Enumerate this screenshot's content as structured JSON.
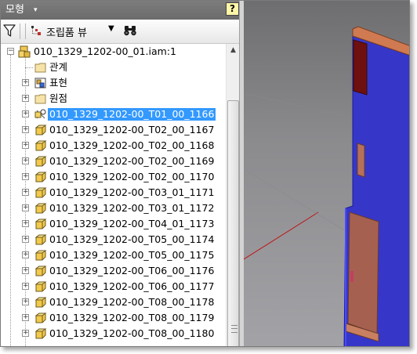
{
  "panel": {
    "title": "모형",
    "title_dropdown_glyph": "▾",
    "help_label": "?"
  },
  "toolbar": {
    "filter_icon": "funnel-icon",
    "view_label": "조립품 뷰",
    "view_dropdown_glyph": "▼",
    "find_icon": "binoculars-icon"
  },
  "tree": {
    "root": {
      "label": "010_1329_1202-00_01.iam:1",
      "icon": "assembly-icon"
    },
    "folders": [
      {
        "label": "관계",
        "icon": "folder-icon",
        "expandable": false
      },
      {
        "label": "표현",
        "icon": "representations-icon",
        "expandable": true
      },
      {
        "label": "원점",
        "icon": "folder-icon",
        "expandable": true
      }
    ],
    "parts": [
      {
        "label": "010_1329_1202-00_T01_00_1166",
        "icon": "part-pattern-icon",
        "selected": true
      },
      {
        "label": "010_1329_1202-00_T02_00_1167",
        "icon": "part-icon",
        "selected": false
      },
      {
        "label": "010_1329_1202-00_T02_00_1168",
        "icon": "part-icon",
        "selected": false
      },
      {
        "label": "010_1329_1202-00_T02_00_1169",
        "icon": "part-icon",
        "selected": false
      },
      {
        "label": "010_1329_1202-00_T02_00_1170",
        "icon": "part-icon",
        "selected": false
      },
      {
        "label": "010_1329_1202-00_T03_01_1171",
        "icon": "part-icon",
        "selected": false
      },
      {
        "label": "010_1329_1202-00_T03_01_1172",
        "icon": "part-icon",
        "selected": false
      },
      {
        "label": "010_1329_1202-00_T04_01_1173",
        "icon": "part-icon",
        "selected": false
      },
      {
        "label": "010_1329_1202-00_T05_00_1174",
        "icon": "part-icon",
        "selected": false
      },
      {
        "label": "010_1329_1202-00_T05_00_1175",
        "icon": "part-icon",
        "selected": false
      },
      {
        "label": "010_1329_1202-00_T06_00_1176",
        "icon": "part-icon",
        "selected": false
      },
      {
        "label": "010_1329_1202-00_T06_00_1177",
        "icon": "part-icon",
        "selected": false
      },
      {
        "label": "010_1329_1202-00_T08_00_1178",
        "icon": "part-icon",
        "selected": false
      },
      {
        "label": "010_1329_1202-00_T08_00_1179",
        "icon": "part-icon",
        "selected": false
      },
      {
        "label": "010_1329_1202-00_T08_00_1180",
        "icon": "part-icon",
        "selected": false
      }
    ]
  },
  "scrollbar": {
    "up_glyph": "▲",
    "down_glyph": "▼"
  },
  "colors": {
    "selection": "#3399ff",
    "panel_title_bg": "#737373",
    "viewport_bg": "#8a8a8d",
    "model_blue": "#3a3ad0",
    "model_wood": "#b87a5a",
    "model_dark_red": "#6a1414"
  }
}
